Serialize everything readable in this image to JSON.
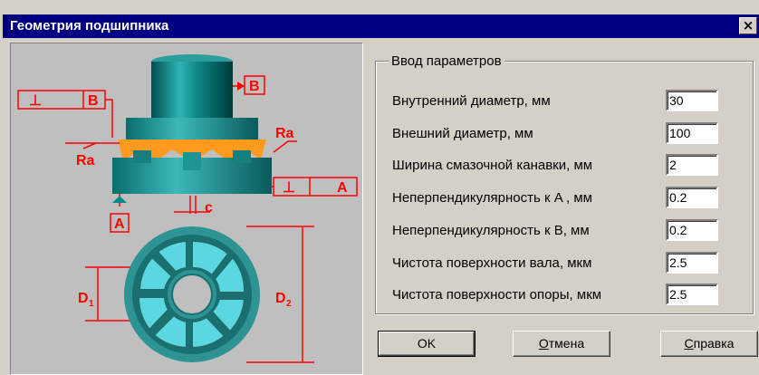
{
  "window": {
    "title": "Геометрия подшипника",
    "close_glyph": "×"
  },
  "figure": {
    "labels": {
      "b_top": "B",
      "b_left": "B",
      "perp_left": "⊥",
      "perp_right": "⊥",
      "a_right": "A",
      "a_bottom": "A",
      "ra_left": "Ra",
      "ra_right": "Ra",
      "c": "c",
      "d1": "D",
      "d1_sub": "1",
      "d2": "D",
      "d2_sub": "2"
    },
    "colors": {
      "shaft": "#008b8b",
      "lube": "#ff8c00",
      "annotation": "#ff0000",
      "disc": "#3ba6a6",
      "segment": "#4fd8e0"
    }
  },
  "group": {
    "title": "Ввод параметров",
    "fields": [
      {
        "label": "Внутренний диаметр, мм",
        "value": "30"
      },
      {
        "label": "Внешний диаметр, мм",
        "value": "100"
      },
      {
        "label": "Ширина смазочной канавки, мм",
        "value": "2"
      },
      {
        "label": "Неперпендикулярность к A , мм",
        "value": "0.2"
      },
      {
        "label": "Неперпендикулярность к B, мм",
        "value": "0.2"
      },
      {
        "label": "Чистота поверхности вала, мкм",
        "value": "2.5"
      },
      {
        "label": "Чистота поверхности опоры, мкм",
        "value": "2.5"
      }
    ]
  },
  "buttons": {
    "ok": "OK",
    "cancel_first": "О",
    "cancel_rest": "тмена",
    "help_first": "С",
    "help_rest": "правка"
  }
}
